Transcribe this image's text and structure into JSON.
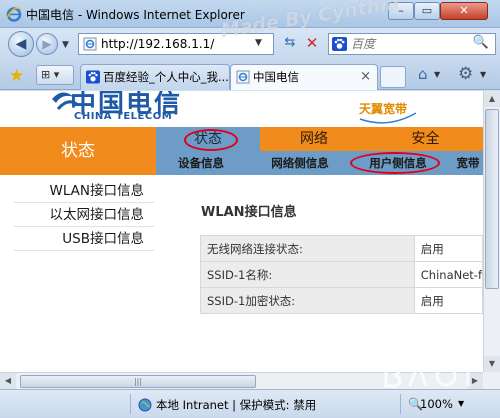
{
  "window": {
    "title": "中国电信 - Windows Internet Explorer",
    "minimize_glyph": "–",
    "maximize_glyph": "▭",
    "close_glyph": "✕"
  },
  "address_bar": {
    "url": "http://192.168.1.1/",
    "search_placeholder": "百度",
    "back_glyph": "◀",
    "forward_glyph": "▶",
    "dropdown_glyph": "▼",
    "refresh_glyph": "⇆",
    "stop_glyph": "✕",
    "search_glyph": "🔍"
  },
  "tabs": {
    "items": [
      {
        "label": "百度经验_个人中心_我..."
      },
      {
        "label": "中国电信",
        "close": "×"
      }
    ],
    "quick_tabs_glyph": "⊞ ▾",
    "favorites_glyph": "★",
    "home_glyph": "⌂",
    "tools_glyph": "⚙",
    "dropdown_glyph": "▼"
  },
  "page": {
    "brand_cn": "中国电信",
    "brand_en": "CHINA TELECOM",
    "tianyi": "天翼宽带",
    "side_title": "状态",
    "main_nav": [
      {
        "label": "状态"
      },
      {
        "label": "网络"
      },
      {
        "label": "安全"
      }
    ],
    "sub_nav": [
      {
        "label": "设备信息"
      },
      {
        "label": "网络侧信息"
      },
      {
        "label": "用户侧信息"
      },
      {
        "label": "宽带"
      }
    ],
    "left_menu": [
      {
        "label": "WLAN接口信息"
      },
      {
        "label": "以太网接口信息"
      },
      {
        "label": "USB接口信息"
      }
    ],
    "section_title": "WLAN接口信息",
    "table": [
      {
        "label": "无线网络连接状态:",
        "value": "启用"
      },
      {
        "label": "SSID-1名称:",
        "value": "ChinaNet-f"
      },
      {
        "label": "SSID-1加密状态:",
        "value": "启用"
      }
    ]
  },
  "scrollbars": {
    "up": "▲",
    "down": "▼",
    "left": "◀",
    "right": "▶",
    "grip": "|||"
  },
  "status_bar": {
    "zone": "本地 Intranet | 保护模式: 禁用",
    "zoom": "100%",
    "zoom_glyph": "🔍",
    "dropdown_glyph": "▼"
  },
  "watermark": {
    "top": "Made By Cynthia"
  },
  "colors": {
    "nav_orange": "#f08b1c",
    "nav_blue": "#6d9cc7",
    "brand_blue": "#1f5aa8",
    "highlight_red": "#e0001b"
  }
}
